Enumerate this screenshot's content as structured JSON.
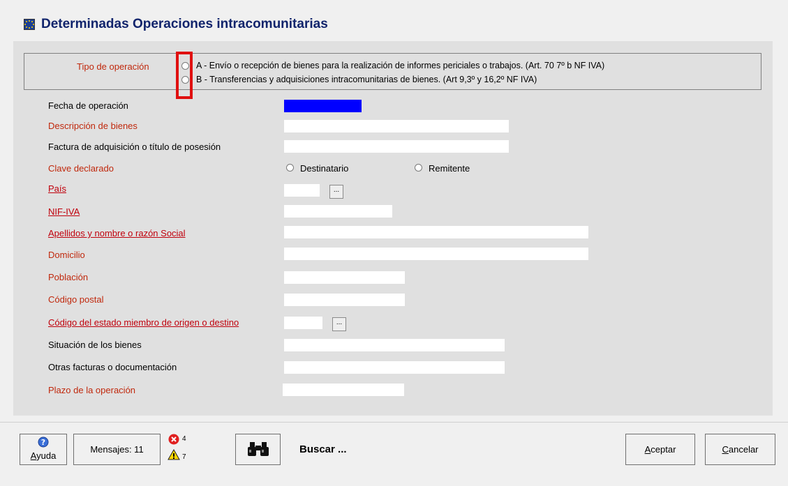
{
  "window": {
    "title": "Determinadas Operaciones intracomunitarias"
  },
  "tipo_operacion": {
    "label": "Tipo de operación",
    "option_a": "A - Envío o recepción de bienes para la realización de informes periciales o trabajos. (Art. 70 7º b NF IVA)",
    "option_b": "B - Transferencias y adquisiciones intracomunitarias de bienes. (Art 9,3º y 16,2º NF IVA)"
  },
  "fields": {
    "fecha": "Fecha de operación",
    "descripcion": "Descripción de bienes",
    "factura": "Factura de adquisición o título de posesión",
    "clave": "Clave declarado",
    "pais": "País",
    "nif": "NIF-IVA",
    "apellidos": "Apellidos y nombre o razón Social",
    "domicilio": "Domicilio",
    "poblacion": "Población",
    "codigo_postal": "Código postal",
    "codigo_estado": "Código del estado miembro de origen o destino",
    "situacion": "Situación de los bienes",
    "otras_facturas": "Otras facturas o documentación",
    "plazo": "Plazo de la operación"
  },
  "clave_options": {
    "destinatario": "Destinatario",
    "remitente": "Remitente"
  },
  "browse_label": "...",
  "footer": {
    "ayuda_prefix": "A",
    "ayuda_rest": "yuda",
    "mensajes": "Mensajes: 11",
    "error_count": "4",
    "warning_count": "7",
    "buscar": "Buscar ...",
    "aceptar_prefix": "A",
    "aceptar_rest": "ceptar",
    "cancelar_prefix": "C",
    "cancelar_rest": "ancelar"
  },
  "colors": {
    "title": "#11246c",
    "required_label": "#c0280c",
    "highlight": "#e01010",
    "date_field": "#0000ff"
  },
  "icons": [
    "eu-flag-icon",
    "help-icon",
    "error-icon",
    "warning-icon",
    "binoculars-icon"
  ]
}
